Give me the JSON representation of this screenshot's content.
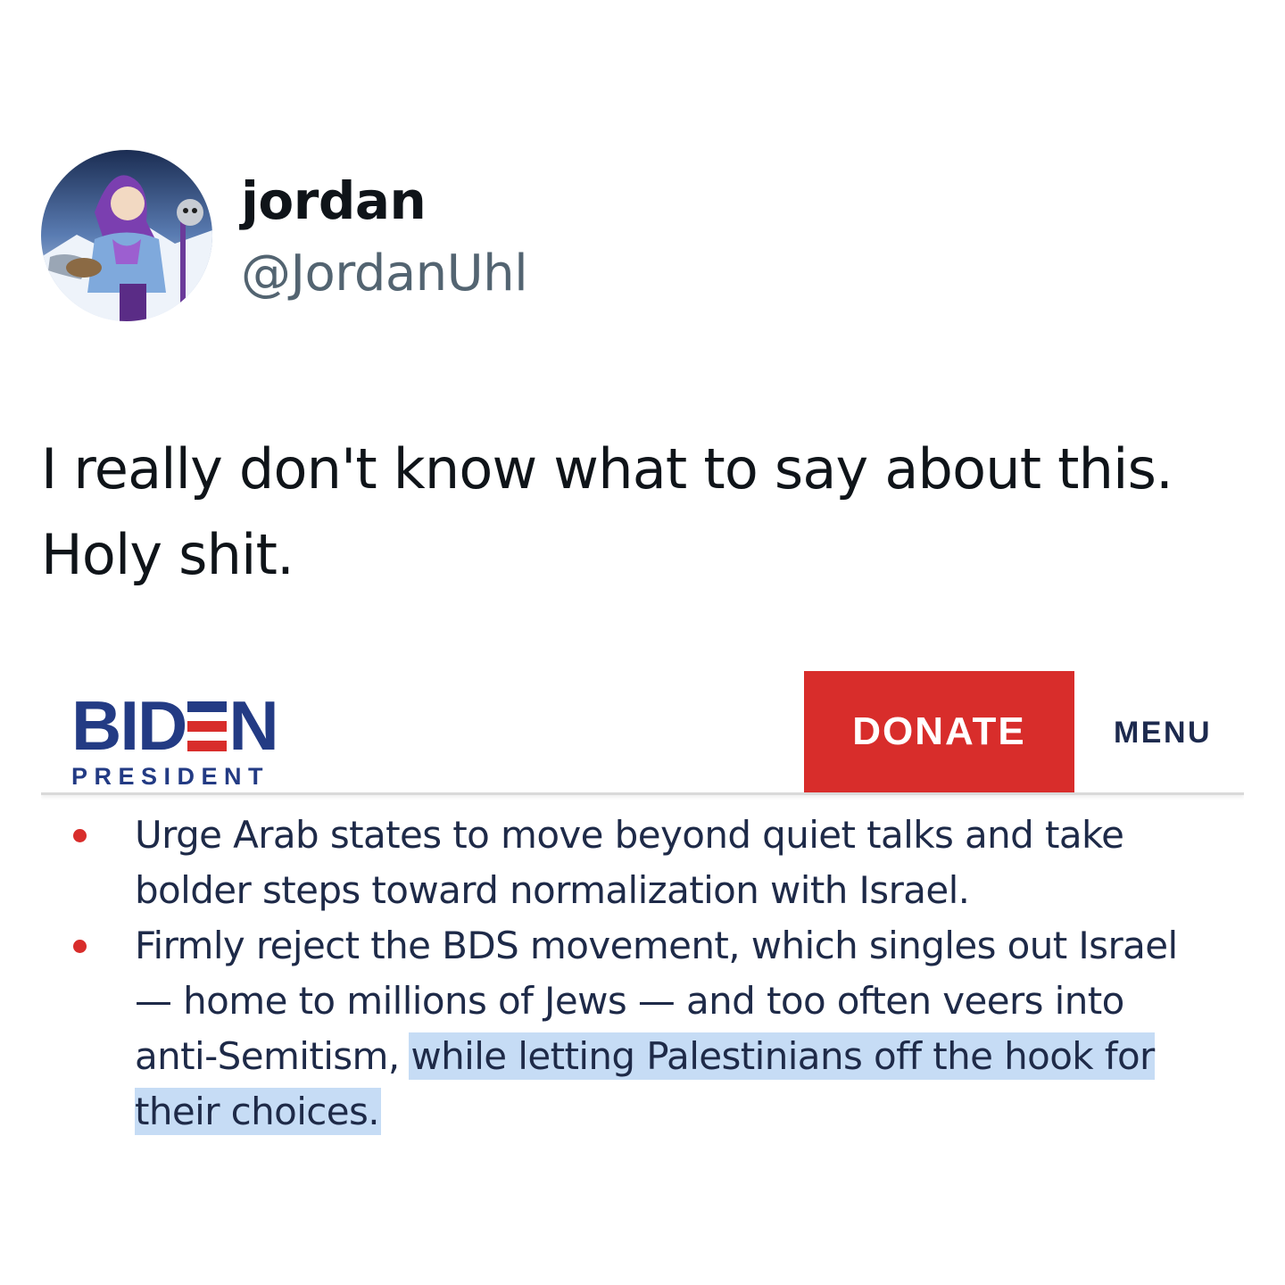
{
  "tweet": {
    "author": {
      "display_name": "jordan",
      "handle": "@JordanUhl"
    },
    "text_line1": "I really don't know what to say about this.",
    "text_line2": "Holy shit."
  },
  "embed": {
    "logo": {
      "word_left": "BID",
      "word_right": "N",
      "subtitle": "PRESIDENT",
      "colors": {
        "blue": "#233b84",
        "red": "#d82d2b",
        "white": "#ffffff"
      }
    },
    "donate_label": "DONATE",
    "menu_label": "MENU",
    "bullets": [
      {
        "text": "Urge Arab states to move beyond quiet talks and take bolder steps toward normalization with Israel."
      },
      {
        "text_plain": "Firmly reject the BDS movement, which singles out Israel — home to millions of Jews — and too often veers into anti-Semitism, ",
        "text_highlighted": "while letting Palestinians off the hook for their choices."
      }
    ],
    "highlight_color": "#c6dcf5",
    "accent_color": "#d82d2b"
  }
}
